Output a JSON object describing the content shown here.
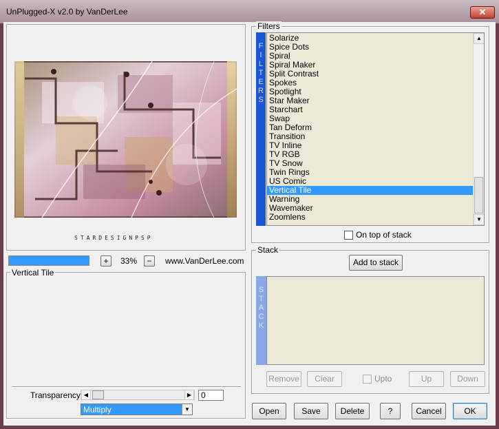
{
  "window": {
    "title": "UnPlugged-X v2.0 by VanDerLee",
    "close_glyph": "✕"
  },
  "preview": {
    "watermark": "STARDESIGNPSP",
    "zoom_minus": "−",
    "zoom_plus": "+",
    "zoom_value": "33%",
    "website": "www.VanDerLee.com",
    "progress": 1.0
  },
  "filter_panel": {
    "title": "Vertical Tile",
    "transparency_label": "Transparency",
    "transparency_value": "0",
    "blend_mode": "Multiply"
  },
  "filters": {
    "label": "Filters",
    "side_label": "FILTERS",
    "items": [
      "Solarize",
      "Spice Dots",
      "Spiral",
      "Spiral Maker",
      "Split Contrast",
      "Spokes",
      "Spotlight",
      "Star Maker",
      "Starchart",
      "Swap",
      "Tan Deform",
      "Transition",
      "TV Inline",
      "TV RGB",
      "TV Snow",
      "Twin Rings",
      "US Comic",
      "Vertical Tile",
      "Warning",
      "Wavemaker",
      "Zoomlens"
    ],
    "selected": "Vertical Tile",
    "on_top_label": "On top of stack"
  },
  "stack": {
    "label": "Stack",
    "side_label": "STACK",
    "add_label": "Add to stack",
    "remove_label": "Remove",
    "clear_label": "Clear",
    "upto_label": "Upto",
    "up_label": "Up",
    "down_label": "Down"
  },
  "buttons": {
    "open": "Open",
    "save": "Save",
    "delete": "Delete",
    "help": "?",
    "cancel": "Cancel",
    "ok": "OK"
  },
  "colors": {
    "accent": "#3399ff",
    "filters_bar": "#1a56d6",
    "stack_bar": "#8aa8e6",
    "list_bg": "#ece9d8"
  }
}
